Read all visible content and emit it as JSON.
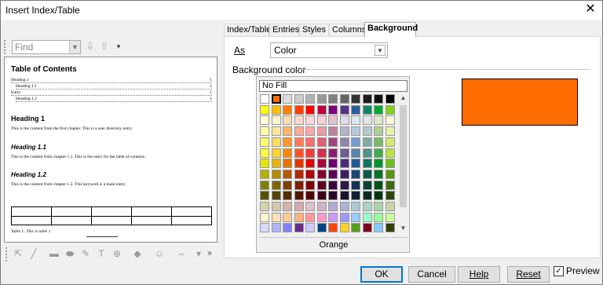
{
  "window": {
    "title": "Insert Index/Table",
    "close_glyph": "✕"
  },
  "find": {
    "placeholder": "Find"
  },
  "preview_doc": {
    "toc_title": "Table of Contents",
    "toc_entries": [
      {
        "label": "Heading 1",
        "page": "1"
      },
      {
        "label": "Heading 1.1",
        "page": "1"
      },
      {
        "label": "Entry",
        "page": "1"
      },
      {
        "label": "Heading 1.2",
        "page": "1"
      }
    ],
    "h1": "Heading 1",
    "p1": "This is the content from the first chapter. This is a user directory entry.",
    "h11": "Heading 1.1",
    "p11": "This is the content from chapter 1.1. This is the entry for the table of contents.",
    "h12": "Heading 1.2",
    "p12": "This is the content from chapter 1.2. This keyword is a main entry.",
    "table_caption": "Table 1: This is table 1"
  },
  "tabs": [
    "Index/Table",
    "Entries",
    "Styles",
    "Columns",
    "Background"
  ],
  "active_tab": "Background",
  "background": {
    "as_label": "As",
    "as_value": "Color",
    "section_label": "Background color",
    "no_fill": "No Fill",
    "selected_color_name": "Orange",
    "selected_color": "#ff6d00"
  },
  "buttons": {
    "ok": "OK",
    "cancel": "Cancel",
    "help": "Help",
    "reset": "Reset"
  },
  "preview_checkbox": {
    "label": "Preview",
    "checked": true
  }
}
